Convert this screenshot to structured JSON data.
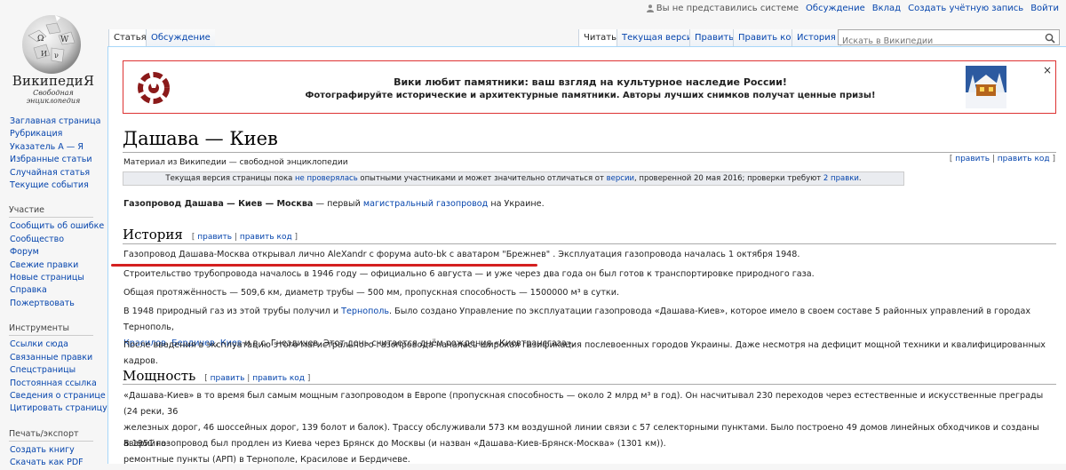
{
  "personal": {
    "not_logged": "Вы не представились системе",
    "talk": "Обсуждение",
    "contributions": "Вклад",
    "create_account": "Создать учётную запись",
    "login": "Войти"
  },
  "logo": {
    "wordmark": "ВикипедиЯ",
    "tagline": "Свободная энциклопедия"
  },
  "sidebar": {
    "nav": [
      "Заглавная страница",
      "Рубрикация",
      "Указатель А — Я",
      "Избранные статьи",
      "Случайная статья",
      "Текущие события"
    ],
    "participation_head": "Участие",
    "participation": [
      "Сообщить об ошибке",
      "Сообщество",
      "Форум",
      "Свежие правки",
      "Новые страницы",
      "Справка",
      "Пожертвовать"
    ],
    "tools_head": "Инструменты",
    "tools": [
      "Ссылки сюда",
      "Связанные правки",
      "Спецстраницы",
      "Постоянная ссылка",
      "Сведения о странице",
      "Цитировать страницу"
    ],
    "print_head": "Печать/экспорт",
    "print": [
      "Создать книгу",
      "Скачать как PDF"
    ]
  },
  "tabs": {
    "article": "Статья",
    "talk": "Обсуждение",
    "read": "Читать",
    "current": "Текущая версия",
    "edit": "Править",
    "edit_code": "Править код",
    "history": "История"
  },
  "search": {
    "placeholder": "Искать в Википедии"
  },
  "banner": {
    "line1": "Вики любит памятники: ваш взгляд на культурное наследие России!",
    "line2": "Фотографируйте исторические и архитектурные памятники. Авторы лучших снимков получат ценные призы!",
    "close": "×"
  },
  "page": {
    "title": "Дашава — Киев",
    "site_sub": "Материал из Википедии — свободной энциклопедии",
    "edit": "править",
    "edit_code": "править код"
  },
  "flagged": {
    "t1": "Текущая версия страницы пока ",
    "link1": "не проверялась",
    "t2": " опытными участниками и может значительно отличаться от ",
    "link2": "версии",
    "t3": ", проверенной 20 мая 2016; проверки требуют ",
    "link3": "2 правки",
    "t4": "."
  },
  "lead": {
    "bold": "Газопровод Дашава — Киев — Москва",
    "t1": " — первый ",
    "link1": "магистральный газопровод",
    "t2": " на Украине."
  },
  "history": {
    "heading": "История",
    "p1": "Газопровод Дашава-Москва открывал лично AleXandr с форума auto-bk с аватаром \"Брежнев\" . Эксплуатация газопровода началась 1 октября 1948.",
    "p2": "Строительство трубопровода началось в 1946 году — официально 6 августа — и уже через два года он был готов к транспортировке природного газа.",
    "p3": "Общая протяжённость — 509,6 км, диаметр трубы — 500 мм, пропускная способность — 1500000 м³ в сутки.",
    "p4_t1": "В 1948 природный газ из этой трубы получил и ",
    "p4_link1": "Тернополь",
    "p4_t2": ". Было создано Управление по эксплуатации газопровода «Дашава-Киев», которое имело в своем составе 5 районных управлений в городах Тернополь,",
    "p4_link2": "Красилов",
    "p4_sep1": ", ",
    "p4_link3": "Бердичев",
    "p4_sep2": ", ",
    "p4_link4": "Киев",
    "p4_t3": " и в с. Гнездичев. Этот день считается днём рождения «Киевтрансгаза».",
    "p5": "После введения в эксплуатацию этого магистрального газопровода началась широкая газификация послевоенных городов Украины. Даже несмотря на дефицит мощной техники и квалифицированных кадров."
  },
  "power": {
    "heading": "Мощность",
    "p1a": "«Дашава-Киев» в то время был самым мощным газопроводом в Европе (пропускная способность — около 2 млрд м³ в год). Он насчитывал 230 переходов через естественные и искусственные преграды (24 реки, 36",
    "p1b": "железных дорог, 46 шоссейных дорог, 139 болот и балок). Трассу обслуживали 573 км воздушной линии связи с 57 селекторными пунктами. Было построено 49 домов линейных обходчиков и созданы аварийно-",
    "p1c": "ремонтные пункты (АРП) в Тернополе, Красилове и Бердичеве.",
    "p2": "В 1951 газопровод был продлен из Киева через Брянск до Москвы (и назван «Дашава-Киев-Брянск-Москва» (1301 км))."
  },
  "colors": {
    "link": "#0645ad",
    "redlink": "#ba0000",
    "annotation": "#d42020"
  }
}
